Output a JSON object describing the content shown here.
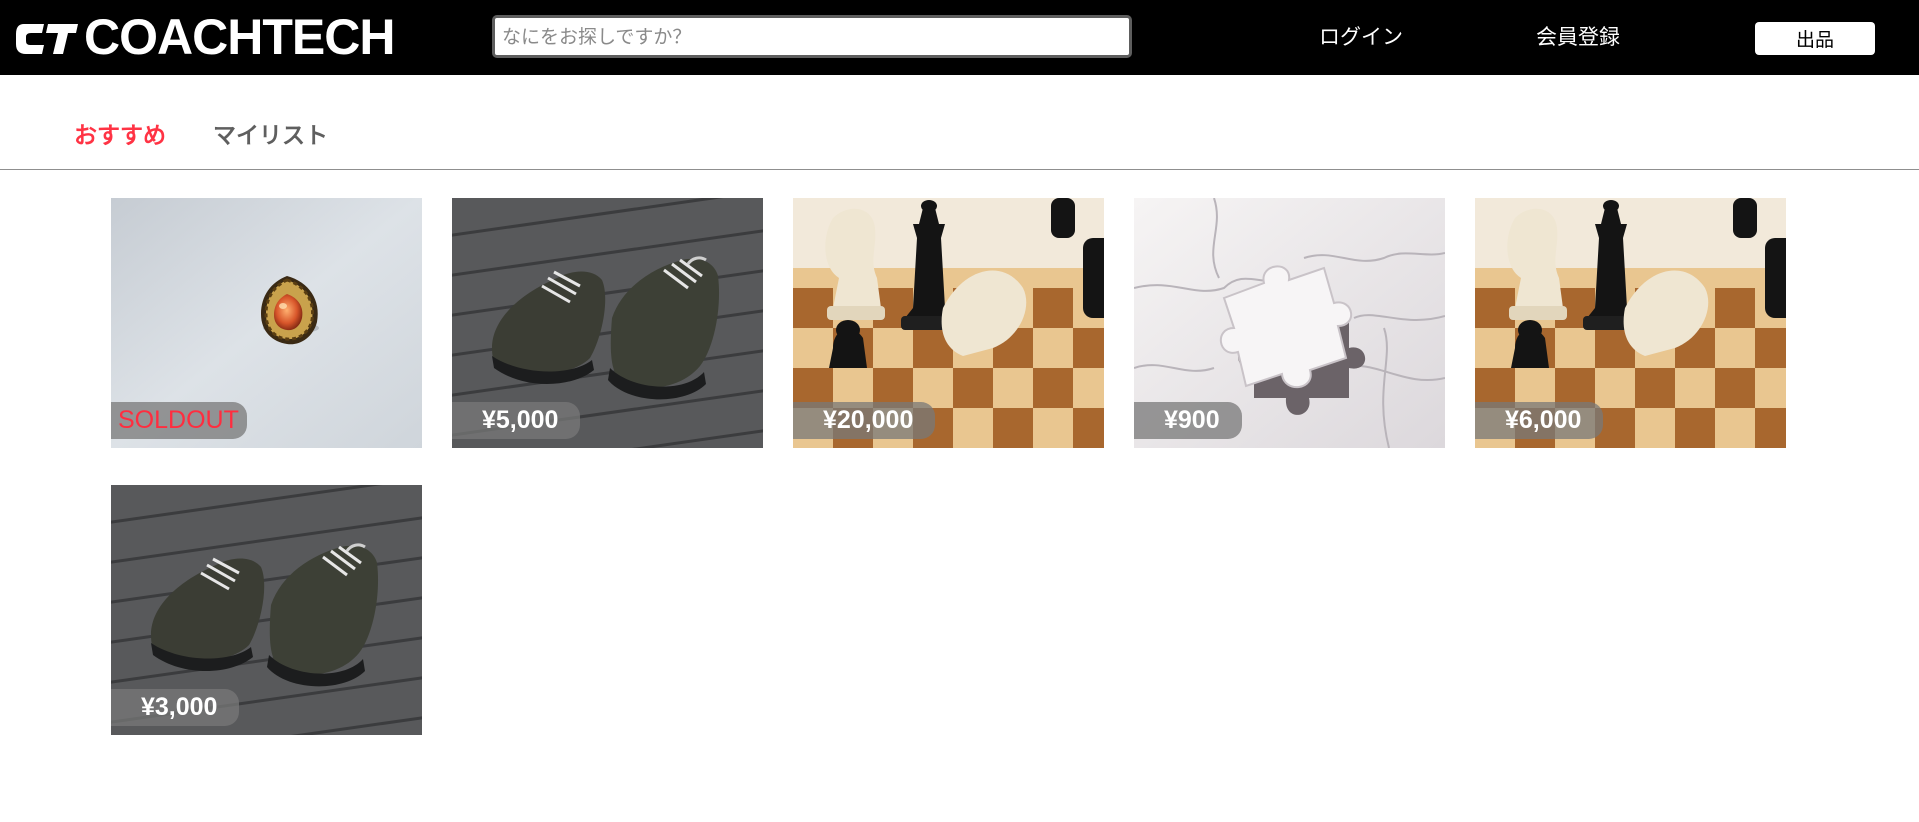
{
  "header": {
    "logo_text": "COACHTECH",
    "search_placeholder": "なにをお探しですか？",
    "login_label": "ログイン",
    "register_label": "会員登録",
    "sell_label": "出品"
  },
  "tabs": {
    "recommended_label": "おすすめ",
    "mylist_label": "マイリスト",
    "active": "recommended"
  },
  "colors": {
    "header_bg": "#000000",
    "accent": "#ff3344",
    "soldout_text": "#ff2d3f"
  },
  "items": [
    {
      "image": "ring-icon",
      "badge": "SOLDOUT",
      "sold_out": true
    },
    {
      "image": "sneakers-icon",
      "badge": "¥5,000",
      "sold_out": false
    },
    {
      "image": "chess-icon",
      "badge": "¥20,000",
      "sold_out": false
    },
    {
      "image": "puzzle-icon",
      "badge": "¥900",
      "sold_out": false
    },
    {
      "image": "chess-icon",
      "badge": "¥6,000",
      "sold_out": false
    },
    {
      "image": "sneakers-icon",
      "badge": "¥3,000",
      "sold_out": false
    }
  ]
}
